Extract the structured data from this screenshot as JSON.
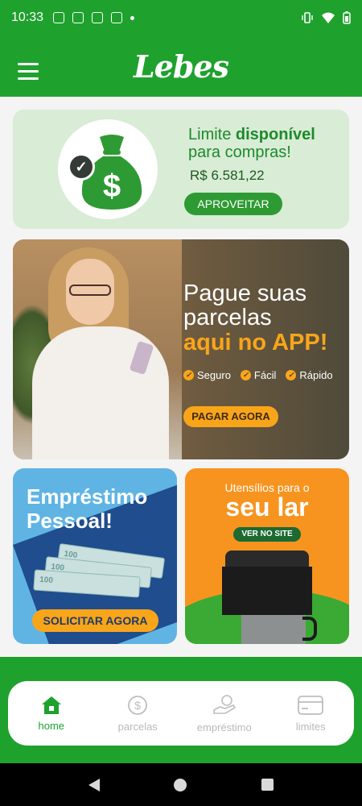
{
  "status_bar": {
    "time": "10:33"
  },
  "header": {
    "logo_text": "Lebes"
  },
  "limit_card": {
    "title_prefix": "Limite ",
    "title_bold": "disponível",
    "title_suffix": " para compras!",
    "value": "R$ 6.581,22",
    "button_label": "APROVEITAR",
    "currency_symbol": "$"
  },
  "pay_banner": {
    "title": "Pague suas parcelas",
    "title_accent": "aqui no APP!",
    "features": [
      "Seguro",
      "Fácil",
      "Rápido"
    ],
    "button_label": "PAGAR AGORA"
  },
  "loan_banner": {
    "title_line1": "Empréstimo",
    "title_line2": "Pessoal!",
    "bill_text": "100",
    "button_label": "SOLICITAR AGORA"
  },
  "home_banner": {
    "subtitle": "Utensílios para o",
    "title": "seu lar",
    "button_label": "VER NO SITE"
  },
  "bottom_nav": [
    {
      "label": "home",
      "icon": "home-icon",
      "active": true
    },
    {
      "label": "parcelas",
      "icon": "dollar-coin-icon",
      "active": false
    },
    {
      "label": "empréstimo",
      "icon": "hand-money-icon",
      "active": false
    },
    {
      "label": "limites",
      "icon": "card-icon",
      "active": false
    }
  ],
  "colors": {
    "brand_green": "#1fa12e",
    "accent_orange": "#f9a51a",
    "loan_blue": "#1f4d8d"
  }
}
